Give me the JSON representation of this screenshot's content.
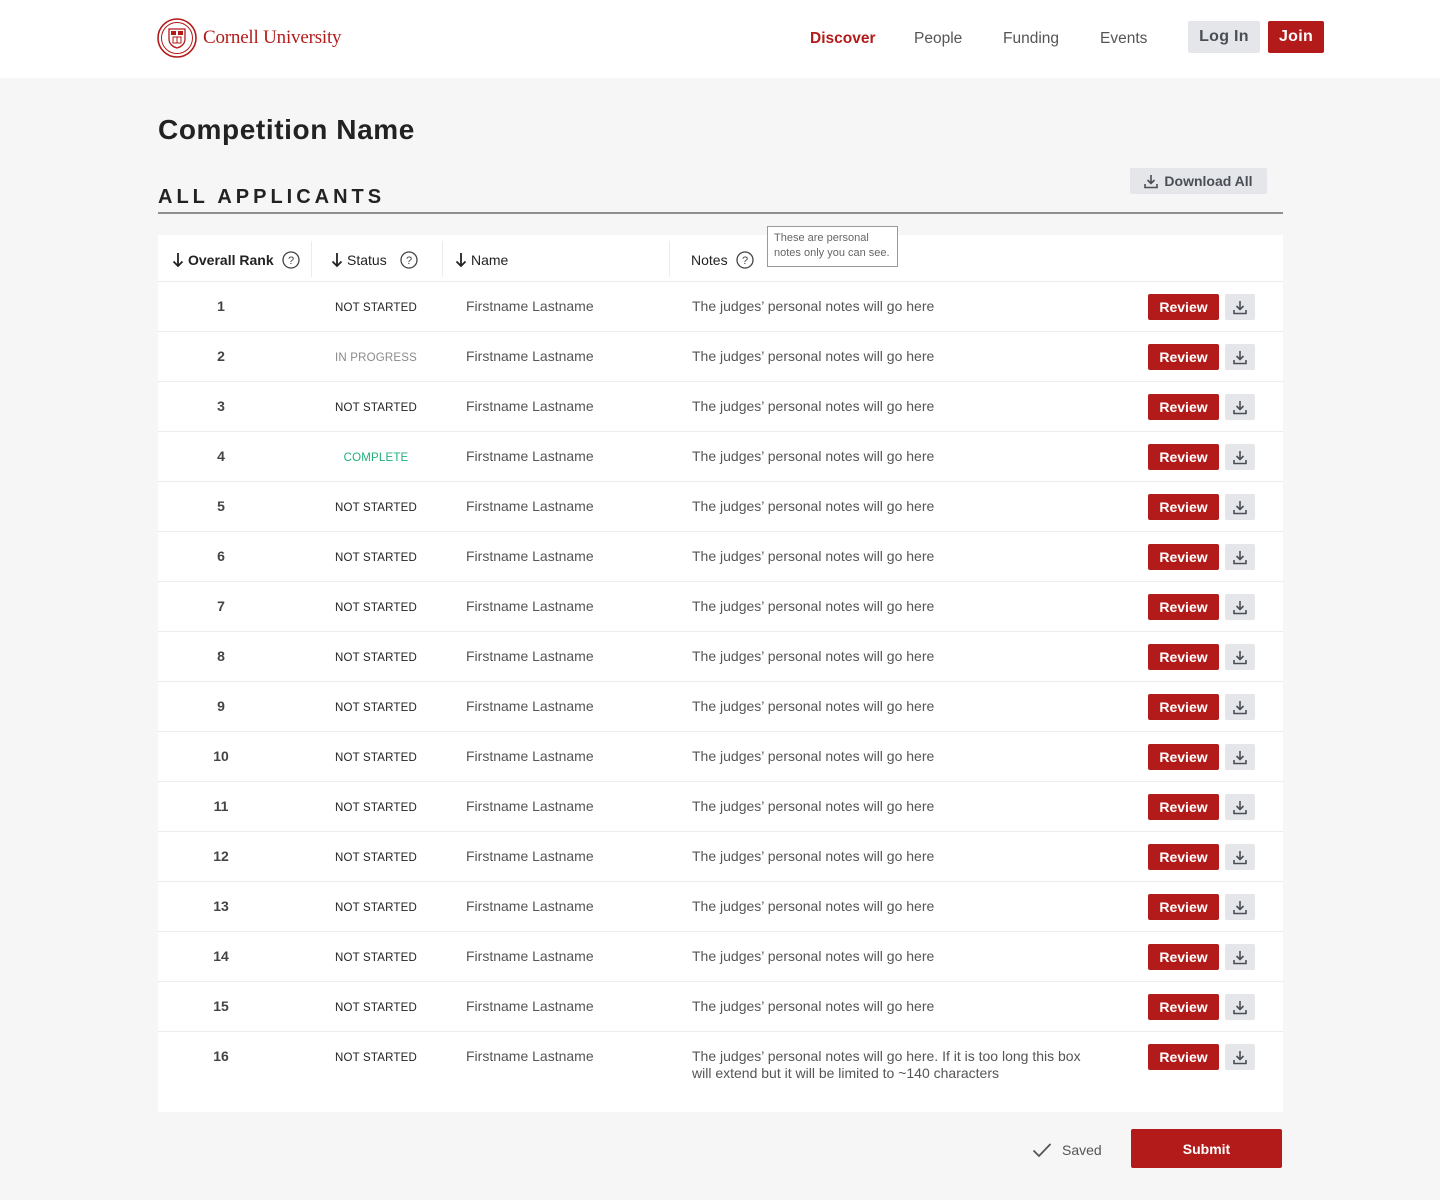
{
  "header": {
    "logo_text": "Cornell University",
    "nav": [
      {
        "label": "Discover",
        "active": true
      },
      {
        "label": "People",
        "active": false
      },
      {
        "label": "Funding",
        "active": false
      },
      {
        "label": "Events",
        "active": false
      }
    ],
    "login_label": "Log In",
    "join_label": "Join"
  },
  "page": {
    "title": "Competition Name",
    "section_title": "ALL APPLICANTS",
    "download_all_label": "Download All"
  },
  "table": {
    "columns": {
      "rank": "Overall Rank",
      "status": "Status",
      "name": "Name",
      "notes": "Notes"
    },
    "notes_tooltip": "These are personal notes only you can see.",
    "review_label": "Review",
    "rows": [
      {
        "rank": "1",
        "status": "NOT STARTED",
        "name": "Firstname Lastname",
        "notes": "The judges’ personal notes will go here"
      },
      {
        "rank": "2",
        "status": "IN PROGRESS",
        "name": "Firstname Lastname",
        "notes": "The judges’ personal notes will go here"
      },
      {
        "rank": "3",
        "status": "NOT STARTED",
        "name": "Firstname Lastname",
        "notes": "The judges’ personal notes will go here"
      },
      {
        "rank": "4",
        "status": "COMPLETE",
        "name": "Firstname Lastname",
        "notes": "The judges’ personal notes will go here"
      },
      {
        "rank": "5",
        "status": "NOT STARTED",
        "name": "Firstname Lastname",
        "notes": "The judges’ personal notes will go here"
      },
      {
        "rank": "6",
        "status": "NOT STARTED",
        "name": "Firstname Lastname",
        "notes": "The judges’ personal notes will go here"
      },
      {
        "rank": "7",
        "status": "NOT STARTED",
        "name": "Firstname Lastname",
        "notes": "The judges’ personal notes will go here"
      },
      {
        "rank": "8",
        "status": "NOT STARTED",
        "name": "Firstname Lastname",
        "notes": "The judges’ personal notes will go here"
      },
      {
        "rank": "9",
        "status": "NOT STARTED",
        "name": "Firstname Lastname",
        "notes": "The judges’ personal notes will go here"
      },
      {
        "rank": "10",
        "status": "NOT STARTED",
        "name": "Firstname Lastname",
        "notes": "The judges’ personal notes will go here"
      },
      {
        "rank": "11",
        "status": "NOT STARTED",
        "name": "Firstname Lastname",
        "notes": "The judges’ personal notes will go here"
      },
      {
        "rank": "12",
        "status": "NOT STARTED",
        "name": "Firstname Lastname",
        "notes": "The judges’ personal notes will go here"
      },
      {
        "rank": "13",
        "status": "NOT STARTED",
        "name": "Firstname Lastname",
        "notes": "The judges’ personal notes will go here"
      },
      {
        "rank": "14",
        "status": "NOT STARTED",
        "name": "Firstname Lastname",
        "notes": "The judges’ personal notes will go here"
      },
      {
        "rank": "15",
        "status": "NOT STARTED",
        "name": "Firstname Lastname",
        "notes": "The judges’ personal notes will go here"
      },
      {
        "rank": "16",
        "status": "NOT STARTED",
        "name": "Firstname Lastname",
        "notes": "The judges’ personal notes will go here. If it is too long this box will extend but it will be limited to ~140 characters"
      }
    ]
  },
  "footer": {
    "saved_label": "Saved",
    "submit_label": "Submit"
  },
  "colors": {
    "brand_red": "#b31b1b",
    "complete_green": "#21b07a",
    "in_progress_gray": "#8a8a8a",
    "secondary_button": "#e4e6ea"
  },
  "icons": {
    "seal": "cornell-seal-icon",
    "download": "download-icon",
    "sort": "sort-arrow-down-icon",
    "help": "help-circle-icon",
    "check": "check-icon"
  }
}
